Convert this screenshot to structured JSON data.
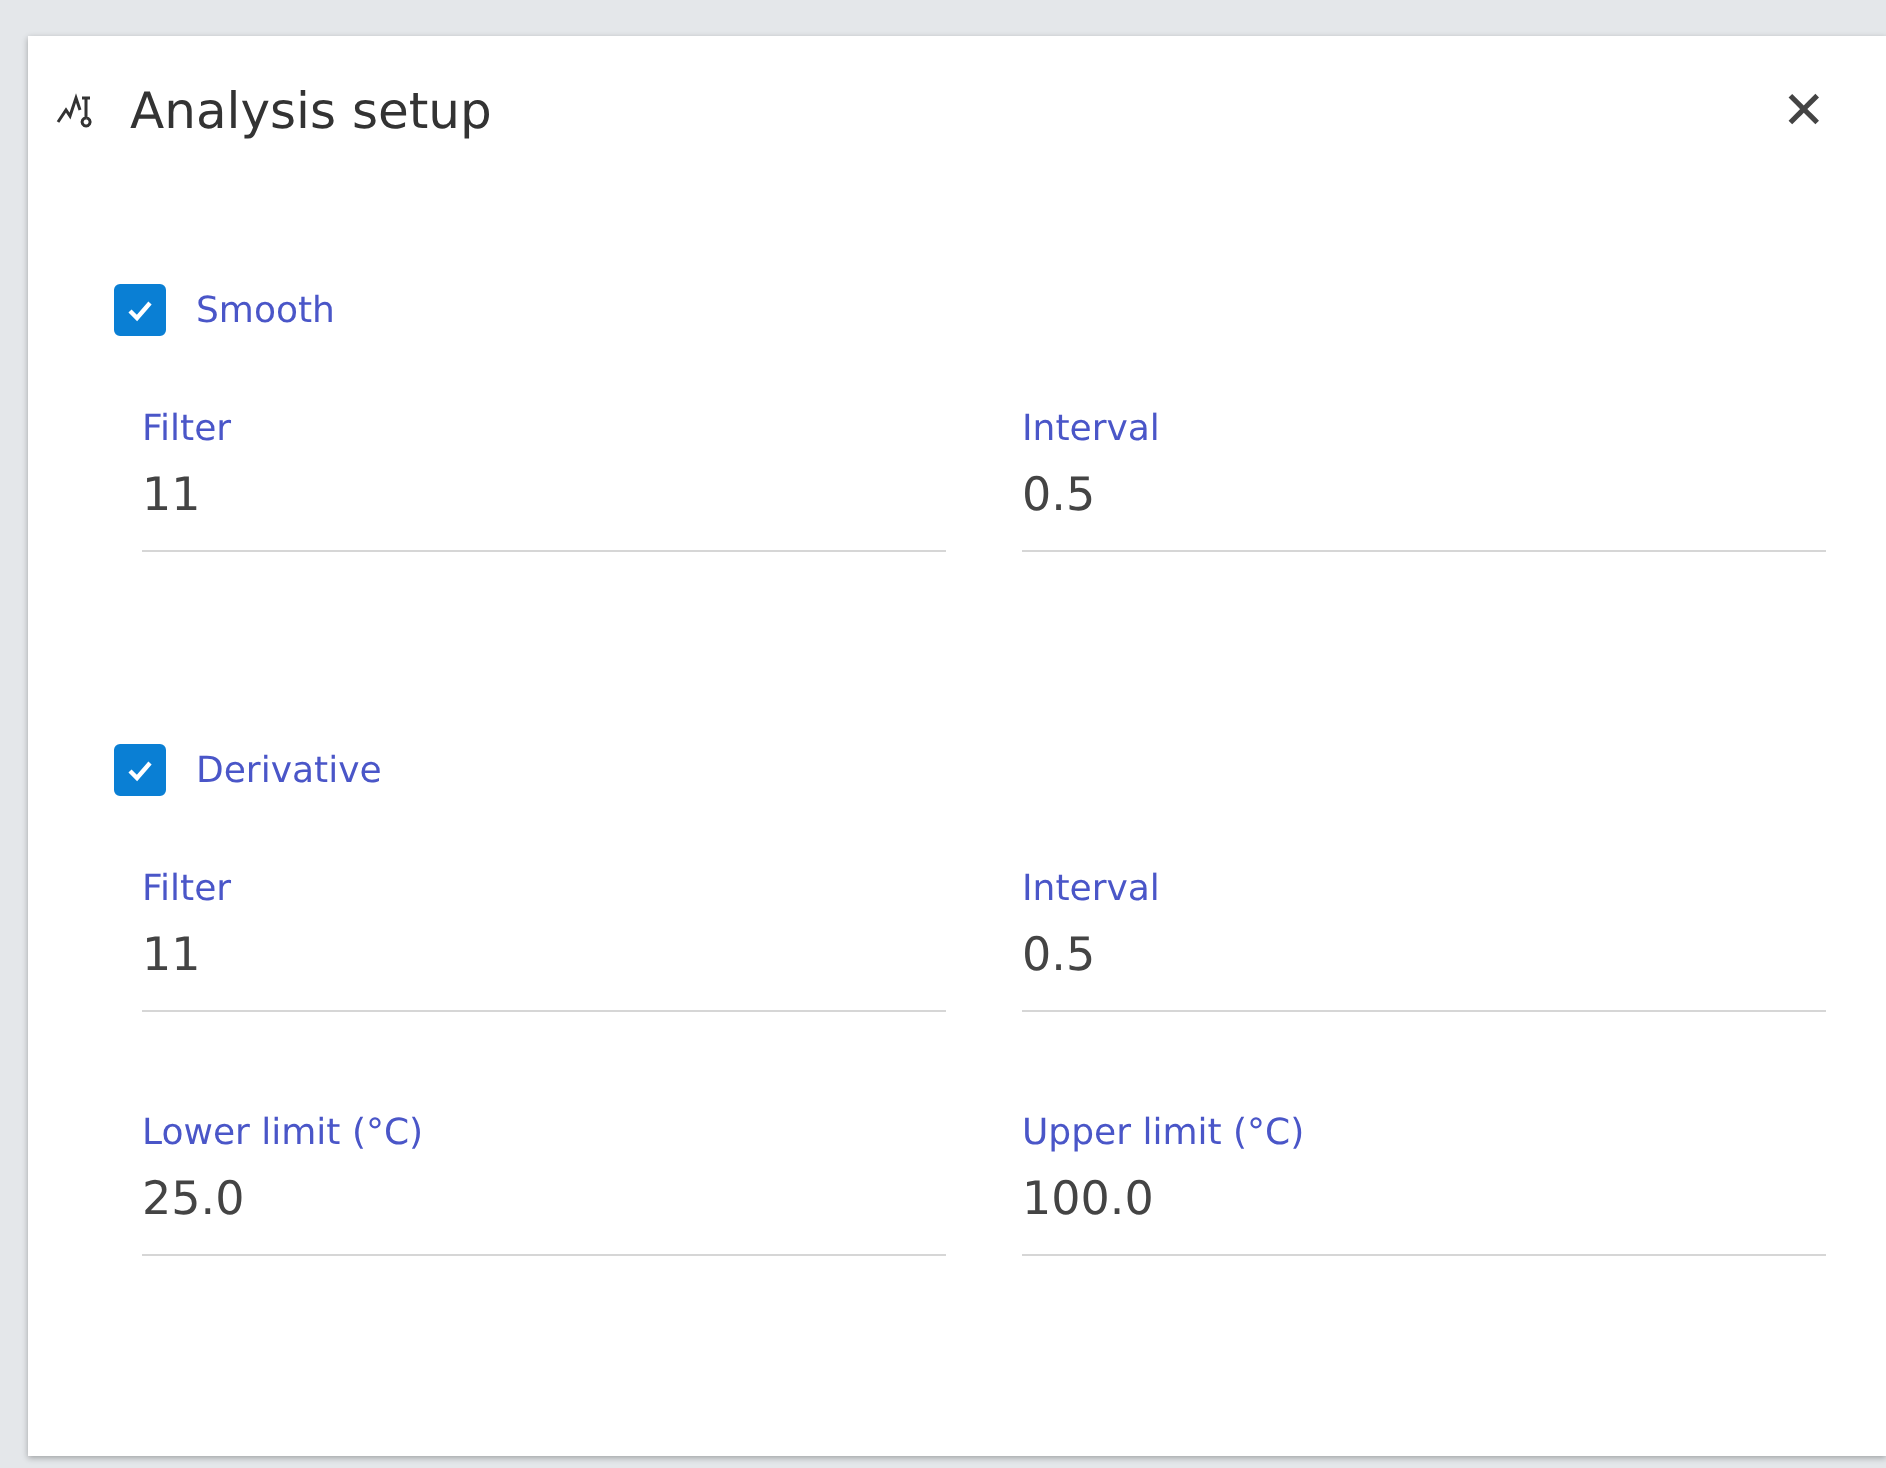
{
  "dialog": {
    "title": "Analysis setup",
    "close": "✕"
  },
  "sections": [
    {
      "label": "Smooth",
      "checked": true,
      "fields": [
        {
          "label": "Filter",
          "value": "11"
        },
        {
          "label": "Interval",
          "value": "0.5"
        }
      ]
    },
    {
      "label": "Derivative",
      "checked": true,
      "fields": [
        {
          "label": "Filter",
          "value": "11"
        },
        {
          "label": "Interval",
          "value": "0.5"
        },
        {
          "label": "Lower limit (°C)",
          "value": "25.0"
        },
        {
          "label": "Upper limit (°C)",
          "value": "100.0"
        }
      ]
    }
  ]
}
